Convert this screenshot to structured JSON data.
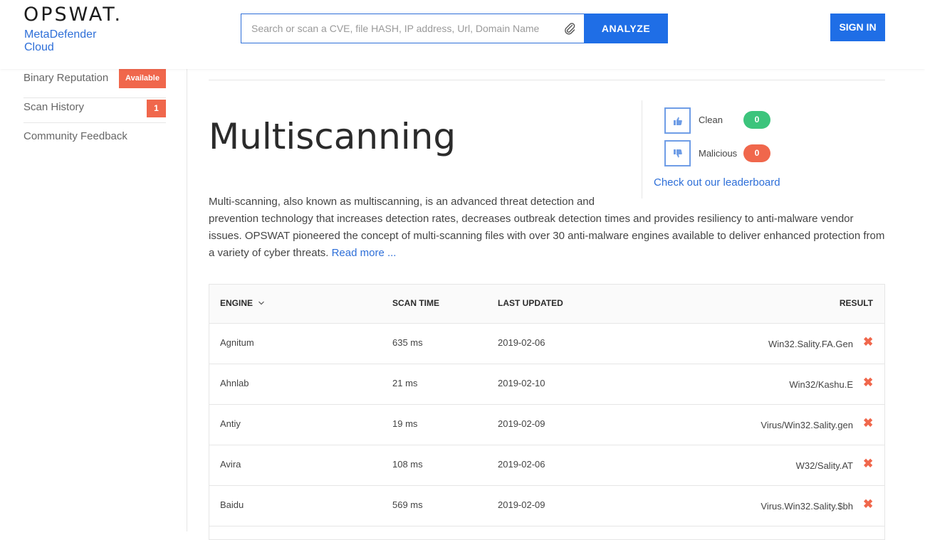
{
  "brand": {
    "logo": "OPSWAT.",
    "product_line1": "MetaDefender",
    "product_line2": "Cloud"
  },
  "search": {
    "placeholder": "Search or scan a CVE, file HASH, IP address, Url, Domain Name",
    "value": ""
  },
  "header": {
    "analyze_label": "ANALYZE",
    "signin_label": "SIGN IN"
  },
  "sidebar": {
    "items": [
      {
        "label": "Binary Reputation",
        "badge": "Available"
      },
      {
        "label": "Scan History",
        "badge": "1"
      },
      {
        "label": "Community Feedback",
        "badge": ""
      }
    ]
  },
  "main": {
    "title": "Multiscanning",
    "description_line1": "Multi-scanning, also known as multiscanning, is an advanced threat detection and",
    "description_rest": "prevention technology that increases detection rates, decreases outbreak detection times and provides resiliency to anti-malware vendor issues. OPSWAT pioneered the concept of multi-scanning files with over 30 anti-malware engines available to deliver enhanced protection from a variety of cyber threats.",
    "read_more": "Read more ..."
  },
  "votes": {
    "clean_label": "Clean",
    "clean_count": "0",
    "malicious_label": "Malicious",
    "malicious_count": "0",
    "leaderboard_link": "Check out our leaderboard"
  },
  "table": {
    "headers": {
      "engine": "ENGINE",
      "scan_time": "SCAN TIME",
      "last_updated": "LAST UPDATED",
      "result": "RESULT"
    },
    "rows": [
      {
        "engine": "Agnitum",
        "scan_time": "635 ms",
        "last_updated": "2019-02-06",
        "result": "Win32.Sality.FA.Gen"
      },
      {
        "engine": "Ahnlab",
        "scan_time": "21 ms",
        "last_updated": "2019-02-10",
        "result": "Win32/Kashu.E"
      },
      {
        "engine": "Antiy",
        "scan_time": "19 ms",
        "last_updated": "2019-02-09",
        "result": "Virus/Win32.Sality.gen"
      },
      {
        "engine": "Avira",
        "scan_time": "108 ms",
        "last_updated": "2019-02-06",
        "result": "W32/Sality.AT"
      },
      {
        "engine": "Baidu",
        "scan_time": "569 ms",
        "last_updated": "2019-02-09",
        "result": "Virus.Win32.Sality.$bh"
      }
    ]
  },
  "colors": {
    "accent": "#1f6ee6",
    "link": "#2e6fd8",
    "danger": "#f0674c",
    "success": "#3cc47c"
  }
}
